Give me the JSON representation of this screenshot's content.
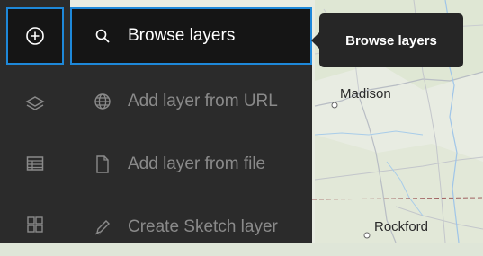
{
  "tooltip": {
    "text": "Browse layers"
  },
  "menu": {
    "items": [
      {
        "label": "Browse layers",
        "icon": "search-icon"
      },
      {
        "label": "Add layer from URL",
        "icon": "globe-icon"
      },
      {
        "label": "Add layer from file",
        "icon": "file-icon"
      },
      {
        "label": "Create Sketch layer",
        "icon": "sketch-icon"
      }
    ]
  },
  "rail": {
    "items": [
      {
        "icon": "add-circle-icon"
      },
      {
        "icon": "layers-icon"
      },
      {
        "icon": "table-icon"
      },
      {
        "icon": "widgets-icon"
      }
    ]
  },
  "map": {
    "labels": [
      "Madison",
      "Rockford"
    ]
  },
  "colors": {
    "accent": "#1e88d9",
    "panel": "#2b2b2b",
    "active_bg": "#151515",
    "tooltip_bg": "#262626"
  }
}
